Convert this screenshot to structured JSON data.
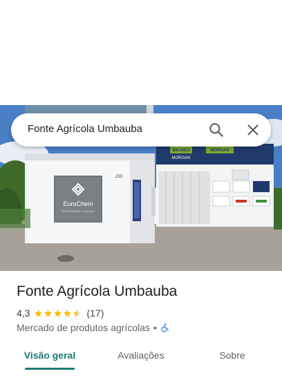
{
  "search": {
    "query": "Fonte Agrícola Umbauba"
  },
  "place": {
    "name": "Fonte Agrícola Umbauba",
    "rating": "4,3",
    "stars_filled": 4.5,
    "stars_total": 5,
    "review_count": "(17)",
    "category": "Mercado de produtos agrícolas",
    "separator": "•"
  },
  "photo_signs": {
    "eurochem": "EuroChem",
    "eurochem_sub": "FERTILIZANTES TOCANTINS",
    "morgan_left": "MORGAN",
    "morgan_right": "MORGAN",
    "number": "233"
  },
  "tabs": [
    {
      "label": "Visão geral",
      "selected": true
    },
    {
      "label": "Avaliações",
      "selected": false
    },
    {
      "label": "Sobre",
      "selected": false
    }
  ],
  "colors": {
    "accent": "#1a7a73",
    "star": "#fbbc04",
    "accessibility": "#1a73e8"
  },
  "icons": {
    "search": "search-icon",
    "close": "close-icon",
    "accessibility": "wheelchair-icon"
  }
}
